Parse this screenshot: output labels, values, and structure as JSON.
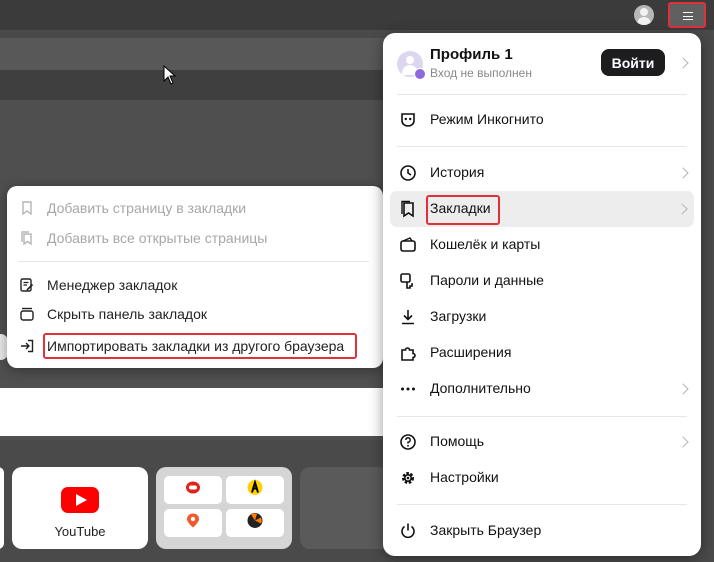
{
  "browser": {
    "youtube_tile_label": "YouTube"
  },
  "bookmarks_submenu": {
    "items": [
      {
        "label": "Добавить страницу в закладки",
        "enabled": false,
        "icon": "bookmark-icon"
      },
      {
        "label": "Добавить все открытые страницы",
        "enabled": false,
        "icon": "bookmarks-stack-icon"
      },
      {
        "label": "Менеджер закладок",
        "enabled": true,
        "icon": "bookmark-manager-icon"
      },
      {
        "label": "Скрыть панель закладок",
        "enabled": true,
        "icon": "hide-panel-icon"
      },
      {
        "label": "Импортировать закладки из другого браузера",
        "enabled": true,
        "icon": "import-icon"
      }
    ]
  },
  "main_menu": {
    "profile": {
      "name": "Профиль 1",
      "status": "Вход не выполнен",
      "login_label": "Войти"
    },
    "items": [
      {
        "label": "Режим Инкогнито",
        "icon": "incognito-icon"
      },
      {
        "label": "История",
        "icon": "clock-icon",
        "has_submenu": true
      },
      {
        "label": "Закладки",
        "icon": "bookmark-icon",
        "has_submenu": true,
        "active": true
      },
      {
        "label": "Кошелёк и карты",
        "icon": "wallet-icon"
      },
      {
        "label": "Пароли и данные",
        "icon": "key-icon"
      },
      {
        "label": "Загрузки",
        "icon": "download-icon"
      },
      {
        "label": "Расширения",
        "icon": "puzzle-icon"
      },
      {
        "label": "Дополнительно",
        "icon": "more-dots-icon",
        "has_submenu": true
      },
      {
        "label": "Помощь",
        "icon": "help-icon",
        "has_submenu": true
      },
      {
        "label": "Настройки",
        "icon": "gear-icon"
      },
      {
        "label": "Закрыть Браузер",
        "icon": "power-icon"
      }
    ]
  },
  "colors": {
    "highlight": "#e0313b",
    "menu_bg": "#ffffff",
    "dark_bg": "#4a4a4a"
  }
}
